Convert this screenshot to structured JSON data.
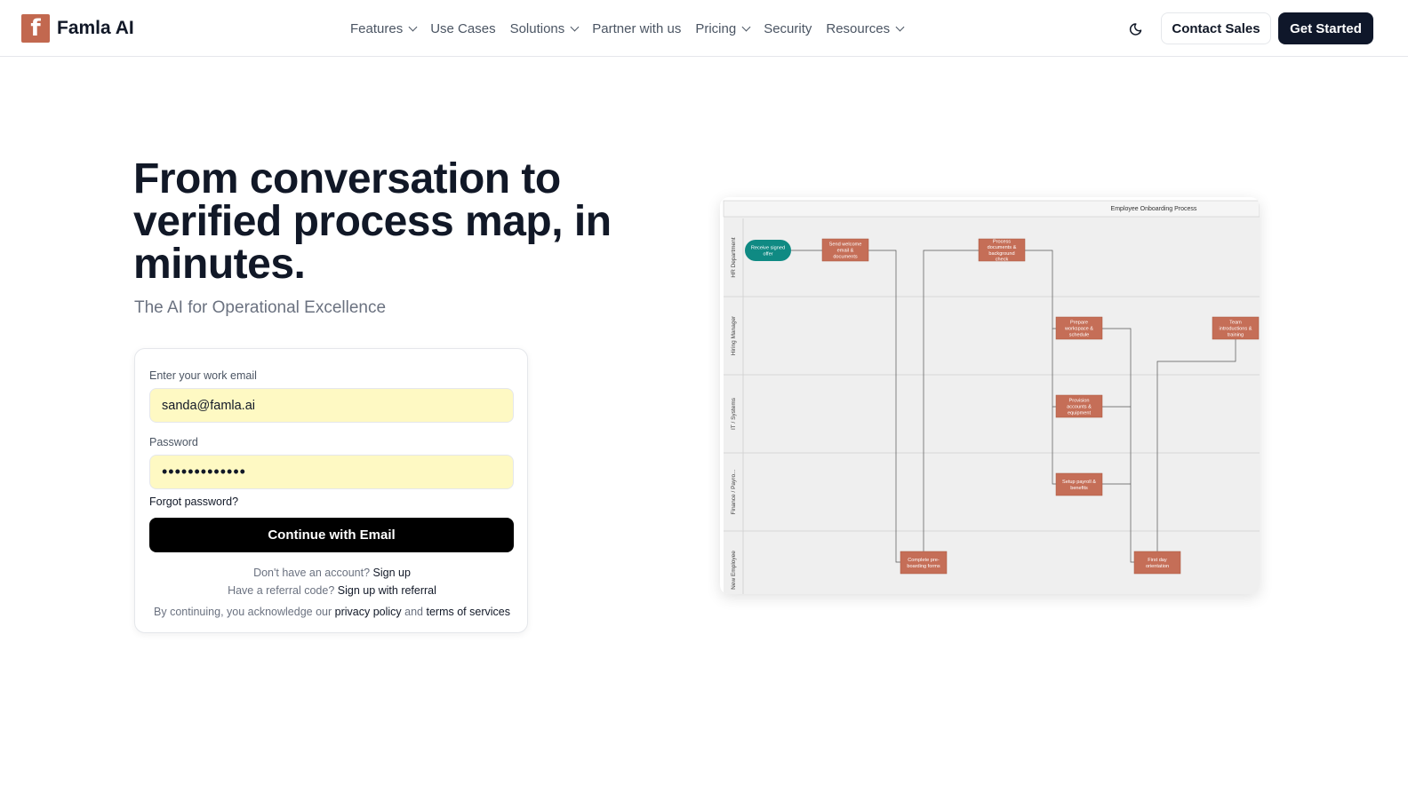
{
  "header": {
    "logo_letter": "f",
    "brand": "Famla AI",
    "nav": [
      {
        "label": "Features",
        "dropdown": true
      },
      {
        "label": "Use Cases",
        "dropdown": false
      },
      {
        "label": "Solutions",
        "dropdown": true
      },
      {
        "label": "Partner with us",
        "dropdown": false
      },
      {
        "label": "Pricing",
        "dropdown": true
      },
      {
        "label": "Security",
        "dropdown": false
      },
      {
        "label": "Resources",
        "dropdown": true
      }
    ],
    "theme_icon": "moon-icon",
    "contact_label": "Contact Sales",
    "start_label": "Get Started"
  },
  "hero": {
    "title": "From conversation to verified process map, in minutes.",
    "subtitle": "The AI for Operational Excellence"
  },
  "login": {
    "email_label": "Enter your work email",
    "email_value": "sanda@famla.ai",
    "password_label": "Password",
    "password_value": "•••••••••••••",
    "forgot": "Forgot password?",
    "continue_label": "Continue with Email",
    "no_account_text": "Don't have an account?",
    "signup_link": "Sign up",
    "referral_text": "Have a referral code?",
    "referral_link": "Sign up with referral",
    "legal_prefix": "By continuing, you acknowledge our",
    "privacy_link": "privacy policy",
    "legal_and": "and",
    "terms_link": "terms of services"
  },
  "diagram": {
    "title": "Employee Onboarding Process",
    "lanes": [
      "HR Department",
      "Hiring Manager",
      "IT / Systems",
      "Finance / Payro...",
      "New Employee"
    ],
    "nodes": [
      {
        "id": "n1",
        "text": [
          "Receive signed",
          "offer"
        ],
        "lane": 0,
        "shape": "pill"
      },
      {
        "id": "n2",
        "text": [
          "Send welcome",
          "email &",
          "documents"
        ],
        "lane": 0,
        "shape": "rect"
      },
      {
        "id": "n3",
        "text": [
          "Process",
          "documents &",
          "background",
          "check"
        ],
        "lane": 0,
        "shape": "rect"
      },
      {
        "id": "n4",
        "text": [
          "Prepare",
          "workspace &",
          "schedule"
        ],
        "lane": 1,
        "shape": "rect"
      },
      {
        "id": "n5",
        "text": [
          "Team",
          "introductions &",
          "training"
        ],
        "lane": 1,
        "shape": "rect"
      },
      {
        "id": "n6",
        "text": [
          "Provision",
          "accounts &",
          "equipment"
        ],
        "lane": 2,
        "shape": "rect"
      },
      {
        "id": "n7",
        "text": [
          "Setup payroll &",
          "benefits"
        ],
        "lane": 3,
        "shape": "rect"
      },
      {
        "id": "n8",
        "text": [
          "Complete pre-",
          "boarding forms"
        ],
        "lane": 4,
        "shape": "rect"
      },
      {
        "id": "n9",
        "text": [
          "First day",
          "orientation"
        ],
        "lane": 4,
        "shape": "rect"
      }
    ],
    "colors": {
      "task": "#c56e57",
      "start": "#0f8a83",
      "lane_bg": "#efefef",
      "edge": "#555555"
    }
  }
}
